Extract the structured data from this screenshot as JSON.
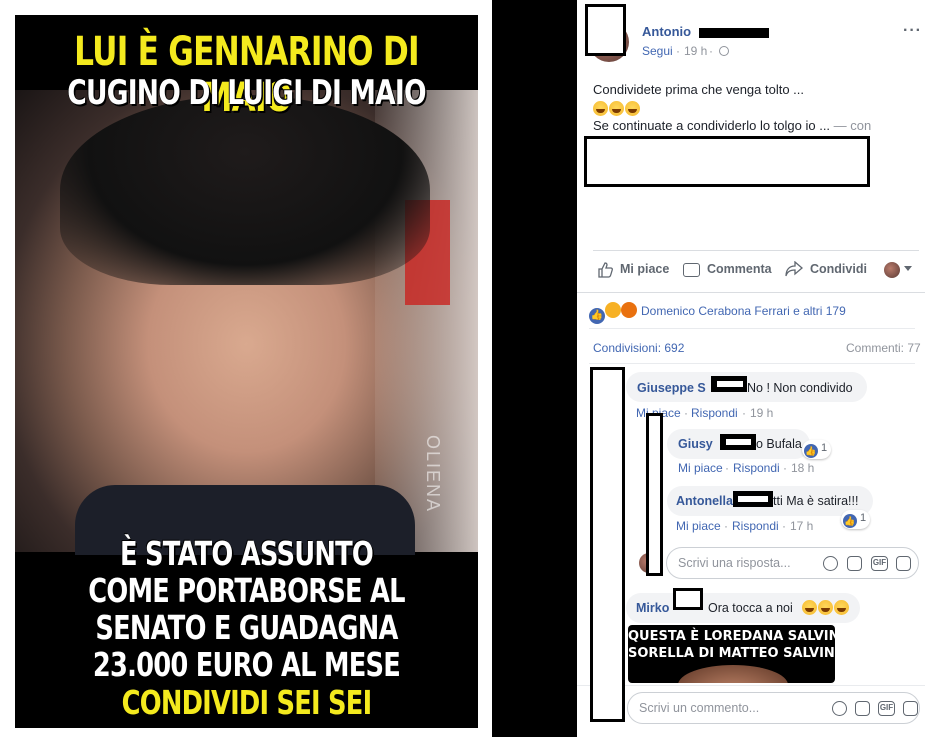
{
  "meme": {
    "line1": "LUI È GENNARINO DI MAIO",
    "line2": "CUGINO DI LUIGI DI MAIO",
    "line3": "È STATO ASSUNTO\nCOME PORTABORSE AL\nSENATO E GUADAGNA\n23.000 EURO AL MESE",
    "line4": "CONDIVIDI SEI SEI INDIGNATO!!!",
    "watermark": "OLIENA"
  },
  "post": {
    "author": "Antonio",
    "follow": "Segui",
    "time": "19 h",
    "body_line1": "Condividete prima che venga tolto ...",
    "body_line3": "Se continuate a condividerlo lo tolgo io ...",
    "with_text": "— con",
    "more_icon": "more-dots-icon"
  },
  "actions": {
    "like": "Mi piace",
    "comment": "Commenta",
    "share": "Condividi"
  },
  "reactions": {
    "text": "Domenico Cerabona Ferrari e altri 179",
    "shares": "Condivisioni: 692",
    "comments": "Commenti: 77"
  },
  "comments": [
    {
      "name": "Giuseppe S",
      "text": "No ! Non condivido",
      "like": "Mi piace",
      "reply": "Rispondi",
      "time": "19 h"
    },
    {
      "name": "Giusy",
      "text": "o Bufala",
      "like": "Mi piace",
      "reply": "Rispondi",
      "time": "18 h",
      "count": "1"
    },
    {
      "name": "Antonella",
      "text": "tti Ma è satira!!!",
      "like": "Mi piace",
      "reply": "Rispondi",
      "time": "17 h",
      "count": "1"
    },
    {
      "name": "Mirko",
      "text": "Ora tocca a noi"
    }
  ],
  "reply_input": {
    "placeholder": "Scrivi una risposta..."
  },
  "comment_input": {
    "placeholder": "Scrivi un commento..."
  },
  "gif_label": "GIF",
  "embedded_meme": {
    "line1": "QUESTA È LOREDANA SALVINI,",
    "line2": "SORELLA DI MATTEO SALVINI"
  },
  "colors": {
    "fb_blue": "#365899",
    "meme_yellow": "#f4ea1e",
    "like_blue": "#4267b2"
  }
}
